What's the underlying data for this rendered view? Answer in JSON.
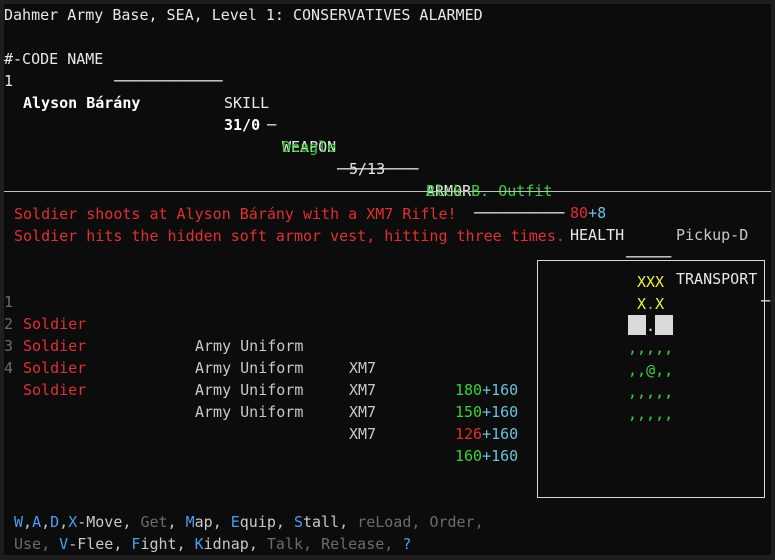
{
  "status": {
    "location": "Dahmer Army Base, SEA, Level 1: CONSERVATIVES ALARMED"
  },
  "squad_header": {
    "code_name": "#-CODE NAME",
    "skill": "SKILL",
    "weapon": "WEAPON",
    "armor": "ARMOR",
    "health": "HEALTH",
    "transport": "TRANSPORT"
  },
  "squad": [
    {
      "num": "1",
      "name": "Alyson Bárány",
      "skill": "31/0",
      "weapon": "Deagle",
      "ammo": "5/13",
      "armor": "Blck B. Outfit",
      "health": "80",
      "health_bonus": "+8",
      "transport": "Pickup-D"
    }
  ],
  "messages": [
    "Soldier shoots at Alyson Bárány with a XM7 Rifle!",
    "Soldier hits the hidden soft armor vest, hitting three times."
  ],
  "enemies": [
    {
      "num": "1",
      "name": "Soldier",
      "armor": "Army Uniform",
      "weapon": "XM7",
      "health": "180",
      "bonus": "+160",
      "health_color": "#3bd13b"
    },
    {
      "num": "2",
      "name": "Soldier",
      "armor": "Army Uniform",
      "weapon": "XM7",
      "health": "150",
      "bonus": "+160",
      "health_color": "#3bd13b"
    },
    {
      "num": "3",
      "name": "Soldier",
      "armor": "Army Uniform",
      "weapon": "XM7",
      "health": "126",
      "bonus": "+160",
      "health_color": "#e03030"
    },
    {
      "num": "4",
      "name": "Soldier",
      "armor": "Army Uniform",
      "weapon": "XM7",
      "health": "160",
      "bonus": "+160",
      "health_color": "#3bd13b"
    }
  ],
  "minimap": {
    "row1": "XXX",
    "row2_left": "X",
    "row2_mid": ".",
    "row2_right": "X",
    "row3_mid": ".",
    "row4": ",,,,,",
    "row5_left": ",,",
    "row5_player": "@",
    "row5_right": ",,",
    "row6": ",,,,,",
    "row7": ",,,,,"
  },
  "commands": {
    "move_keys": [
      "W",
      "A",
      "D",
      "X"
    ],
    "move_label": "-Move",
    "get": "Get",
    "map_key": "M",
    "map_rest": "ap",
    "equip_key": "E",
    "equip_rest": "quip",
    "stall_key": "S",
    "stall_rest": "tall",
    "reload": "reLoad",
    "order": "Order",
    "use": "Use",
    "flee_key": "V",
    "flee_rest": "-Flee",
    "fight_key": "F",
    "fight_rest": "ight",
    "kidnap_key": "K",
    "kidnap_rest": "idnap",
    "talk": "Talk",
    "release": "Release",
    "help": "?"
  },
  "colors": {
    "background": "#0c0c0c",
    "text": "#cfcfcf",
    "enemy": "#e03030",
    "healthy": "#3bd13b",
    "bonus": "#66c2e0",
    "hotkey": "#4a9ff0",
    "disabled": "#6b6b6b",
    "wall": "#f2f23a"
  }
}
